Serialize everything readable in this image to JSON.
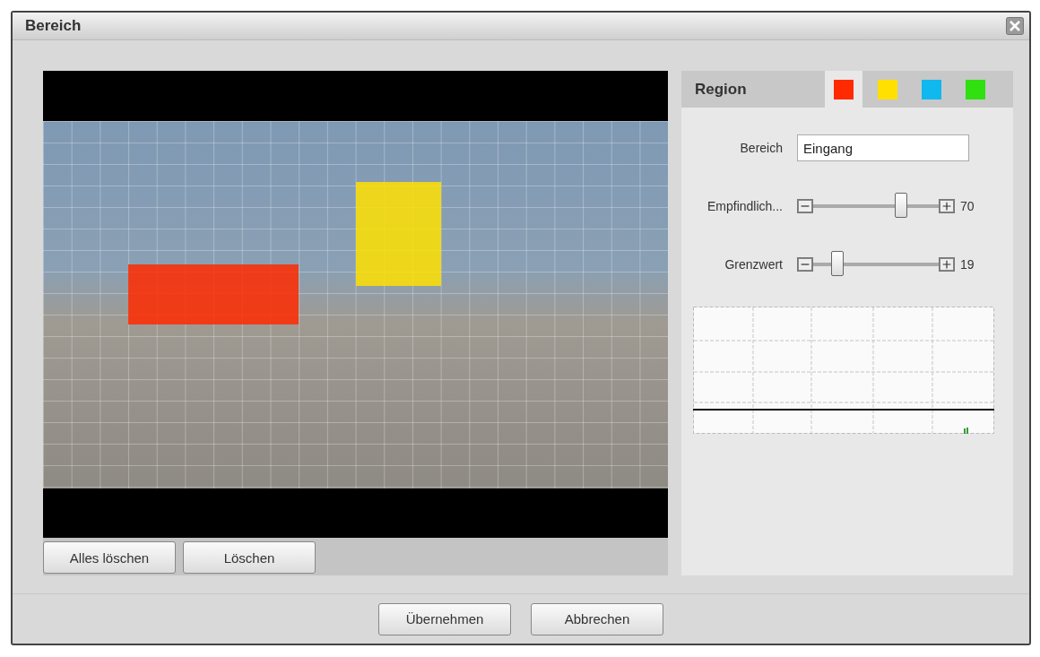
{
  "window": {
    "title": "Bereich"
  },
  "video_actions": [
    {
      "label": "Alles löschen"
    },
    {
      "label": "Löschen"
    }
  ],
  "region_panel": {
    "title": "Region",
    "tabs": [
      {
        "color": "#ff2a00",
        "selected": true
      },
      {
        "color": "#ffe000",
        "selected": false
      },
      {
        "color": "#10b8f0",
        "selected": false
      },
      {
        "color": "#30e010",
        "selected": false
      }
    ],
    "name_label": "Bereich",
    "name_value": "Eingang",
    "sliders": [
      {
        "label": "Empfindlich...",
        "level": 0.7,
        "reading": "70"
      },
      {
        "label": "Grenzwert",
        "level": 0.19,
        "reading": "19"
      }
    ]
  },
  "footer_buttons": [
    {
      "label": "Übernehmen"
    },
    {
      "label": "Abbrechen"
    }
  ]
}
